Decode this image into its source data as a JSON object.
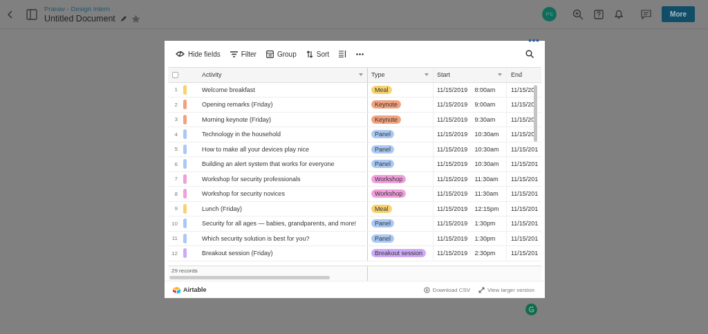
{
  "header": {
    "workspace": "Pranav - Design Intern",
    "title": "Untitled Document",
    "avatar": "PS",
    "more_button": "More"
  },
  "toolbar": {
    "items": [
      "Hide fields",
      "Filter",
      "Group",
      "Sort"
    ]
  },
  "table": {
    "select_all_checked": false,
    "columns": [
      "Activity",
      "Type",
      "Start",
      "End"
    ],
    "rows": [
      {
        "number": "1",
        "activity": "Welcome breakfast",
        "type": "Meal",
        "color": "#f7d26e",
        "date": "11/15/2019",
        "time": "8:00am",
        "end": "11/15/20"
      },
      {
        "number": "2",
        "activity": "Opening remarks (Friday)",
        "type": "Keynote",
        "color": "#f2a27e",
        "date": "11/15/2019",
        "time": "9:00am",
        "end": "11/15/20"
      },
      {
        "number": "3",
        "activity": "Morning keynote (Friday)",
        "type": "Keynote",
        "color": "#f2a27e",
        "date": "11/15/2019",
        "time": "9:30am",
        "end": "11/15/20"
      },
      {
        "number": "4",
        "activity": "Technology in the household",
        "type": "Panel",
        "color": "#a9c9f4",
        "date": "11/15/2019",
        "time": "10:30am",
        "end": "11/15/20"
      },
      {
        "number": "5",
        "activity": "How to make all your devices play nice",
        "type": "Panel",
        "color": "#a9c9f4",
        "date": "11/15/2019",
        "time": "10:30am",
        "end": "11/15/201"
      },
      {
        "number": "6",
        "activity": "Building an alert system that works for everyone",
        "type": "Panel",
        "color": "#a9c9f4",
        "date": "11/15/2019",
        "time": "10:30am",
        "end": "11/15/201"
      },
      {
        "number": "7",
        "activity": "Workshop for security professionals",
        "type": "Workshop",
        "color": "#f09fdc",
        "date": "11/15/2019",
        "time": "11:30am",
        "end": "11/15/201"
      },
      {
        "number": "8",
        "activity": "Workshop for security novices",
        "type": "Workshop",
        "color": "#f09fdc",
        "date": "11/15/2019",
        "time": "11:30am",
        "end": "11/15/201"
      },
      {
        "number": "9",
        "activity": "Lunch (Friday)",
        "type": "Meal",
        "color": "#f7d26e",
        "date": "11/15/2019",
        "time": "12:15pm",
        "end": "11/15/201"
      },
      {
        "number": "10",
        "activity": "Security for all ages — babies, grandparents, and more!",
        "type": "Panel",
        "color": "#a9c9f4",
        "date": "11/15/2019",
        "time": "1:30pm",
        "end": "11/15/201"
      },
      {
        "number": "11",
        "activity": "Which security solution is best for you?",
        "type": "Panel",
        "color": "#a9c9f4",
        "date": "11/15/2019",
        "time": "1:30pm",
        "end": "11/15/201"
      },
      {
        "number": "12",
        "activity": "Breakout session (Friday)",
        "type": "Breakout session",
        "color": "#cdaaf5",
        "date": "11/15/2019",
        "time": "2:30pm",
        "end": "11/15/201"
      }
    ],
    "record_count": "29 records"
  },
  "footer": {
    "brand": "Airtable",
    "download": "Download CSV",
    "view_larger": "View larger version"
  }
}
